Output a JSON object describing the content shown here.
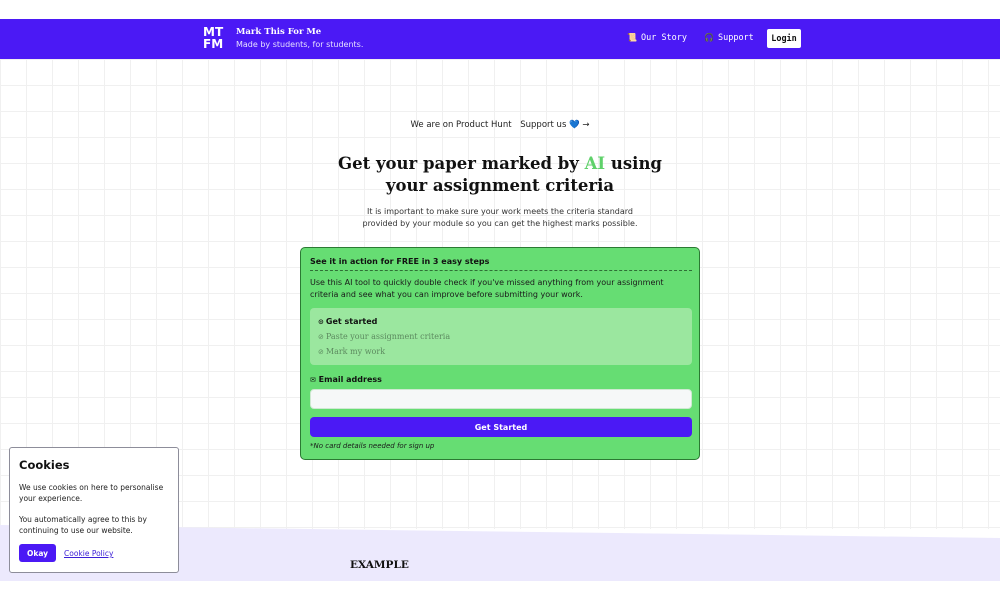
{
  "header": {
    "logo_line1": "MT",
    "logo_line2": "FM",
    "brand_title": "Mark This For Me",
    "brand_subtitle": "Made by students, for students.",
    "nav": [
      {
        "icon": "scroll-icon",
        "label": "Our Story"
      },
      {
        "icon": "headphones-icon",
        "label": "Support"
      }
    ],
    "login_label": "Login"
  },
  "promo": {
    "text": "We are on Product Hunt",
    "support_text": "Support us",
    "heart": "💙",
    "arrow": "→"
  },
  "hero": {
    "title_before": "Get your paper marked by ",
    "title_ai": "AI",
    "title_after": " using",
    "title_line2": "your assignment criteria",
    "subtitle_line1": "It is important to make sure your work meets the criteria standard",
    "subtitle_line2": "provided by your module so you can get the highest marks possible."
  },
  "card": {
    "heading": "See it in action for FREE in 3 easy steps",
    "description": "Use this AI tool to quickly double check if you've missed anything from your assignment criteria and see what you can improve before submitting your work.",
    "steps": [
      {
        "label": "Get started",
        "state": "active"
      },
      {
        "label": "Paste your assignment criteria",
        "state": "todo"
      },
      {
        "label": "Mark my work",
        "state": "todo"
      }
    ],
    "email_label": "Email address",
    "email_value": "",
    "cta_label": "Get Started",
    "note": "*No card details needed for sign up"
  },
  "section": {
    "example_label": "EXAMPLE"
  },
  "cookie": {
    "title": "Cookies",
    "text1": "We use cookies on here to personalise your experience.",
    "text2": "You automatically agree to this by continuing to use our website.",
    "okay_label": "Okay",
    "policy_label": "Cookie Policy"
  },
  "colors": {
    "brand": "#4b19f5",
    "card_green": "#66dd73",
    "ai_green": "#5fd16a"
  }
}
